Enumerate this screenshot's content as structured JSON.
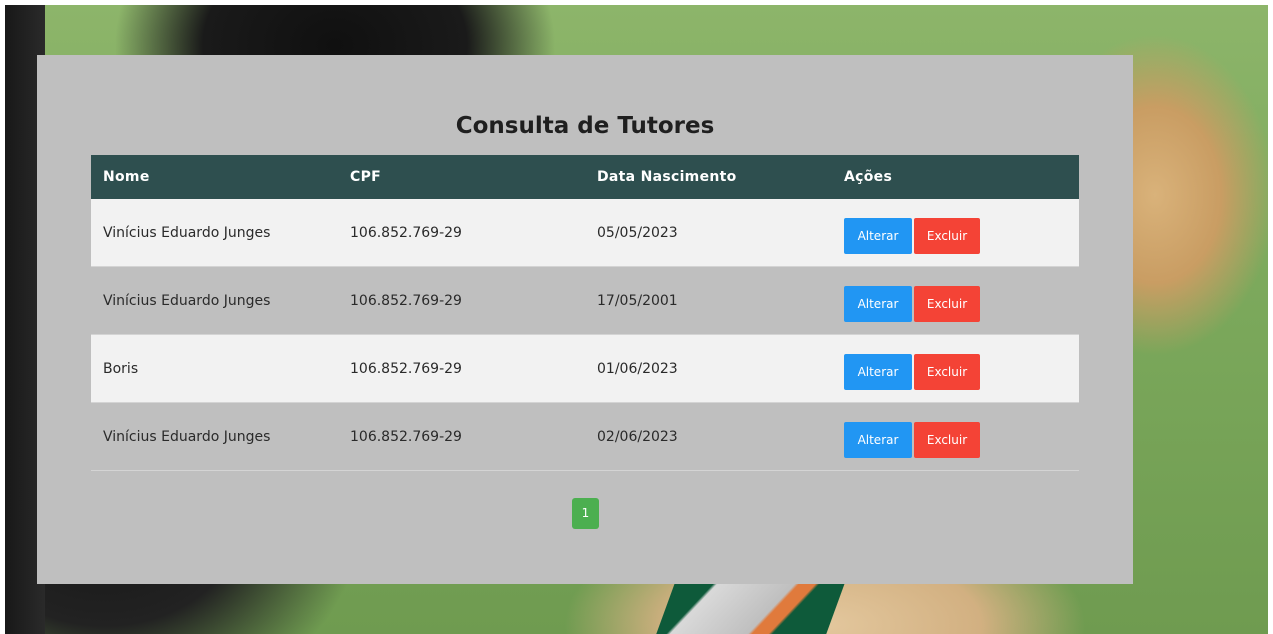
{
  "page": {
    "title": "Consulta de Tutores"
  },
  "table": {
    "headers": {
      "nome": "Nome",
      "cpf": "CPF",
      "data_nascimento": "Data Nascimento",
      "acoes": "Ações"
    },
    "rows": [
      {
        "nome": "Vinícius Eduardo Junges",
        "cpf": "106.852.769-29",
        "data": "05/05/2023"
      },
      {
        "nome": "Vinícius Eduardo Junges",
        "cpf": "106.852.769-29",
        "data": "17/05/2001"
      },
      {
        "nome": "Boris",
        "cpf": "106.852.769-29",
        "data": "01/06/2023"
      },
      {
        "nome": "Vinícius Eduardo Junges",
        "cpf": "106.852.769-29",
        "data": "02/06/2023"
      }
    ],
    "actions": {
      "alterar_label": "Alterar",
      "excluir_label": "Excluir"
    }
  },
  "pagination": {
    "current_page": "1"
  },
  "colors": {
    "header_bg": "#2e4f4f",
    "alterar": "#2196f3",
    "excluir": "#f44336",
    "page_active": "#4caf50"
  }
}
